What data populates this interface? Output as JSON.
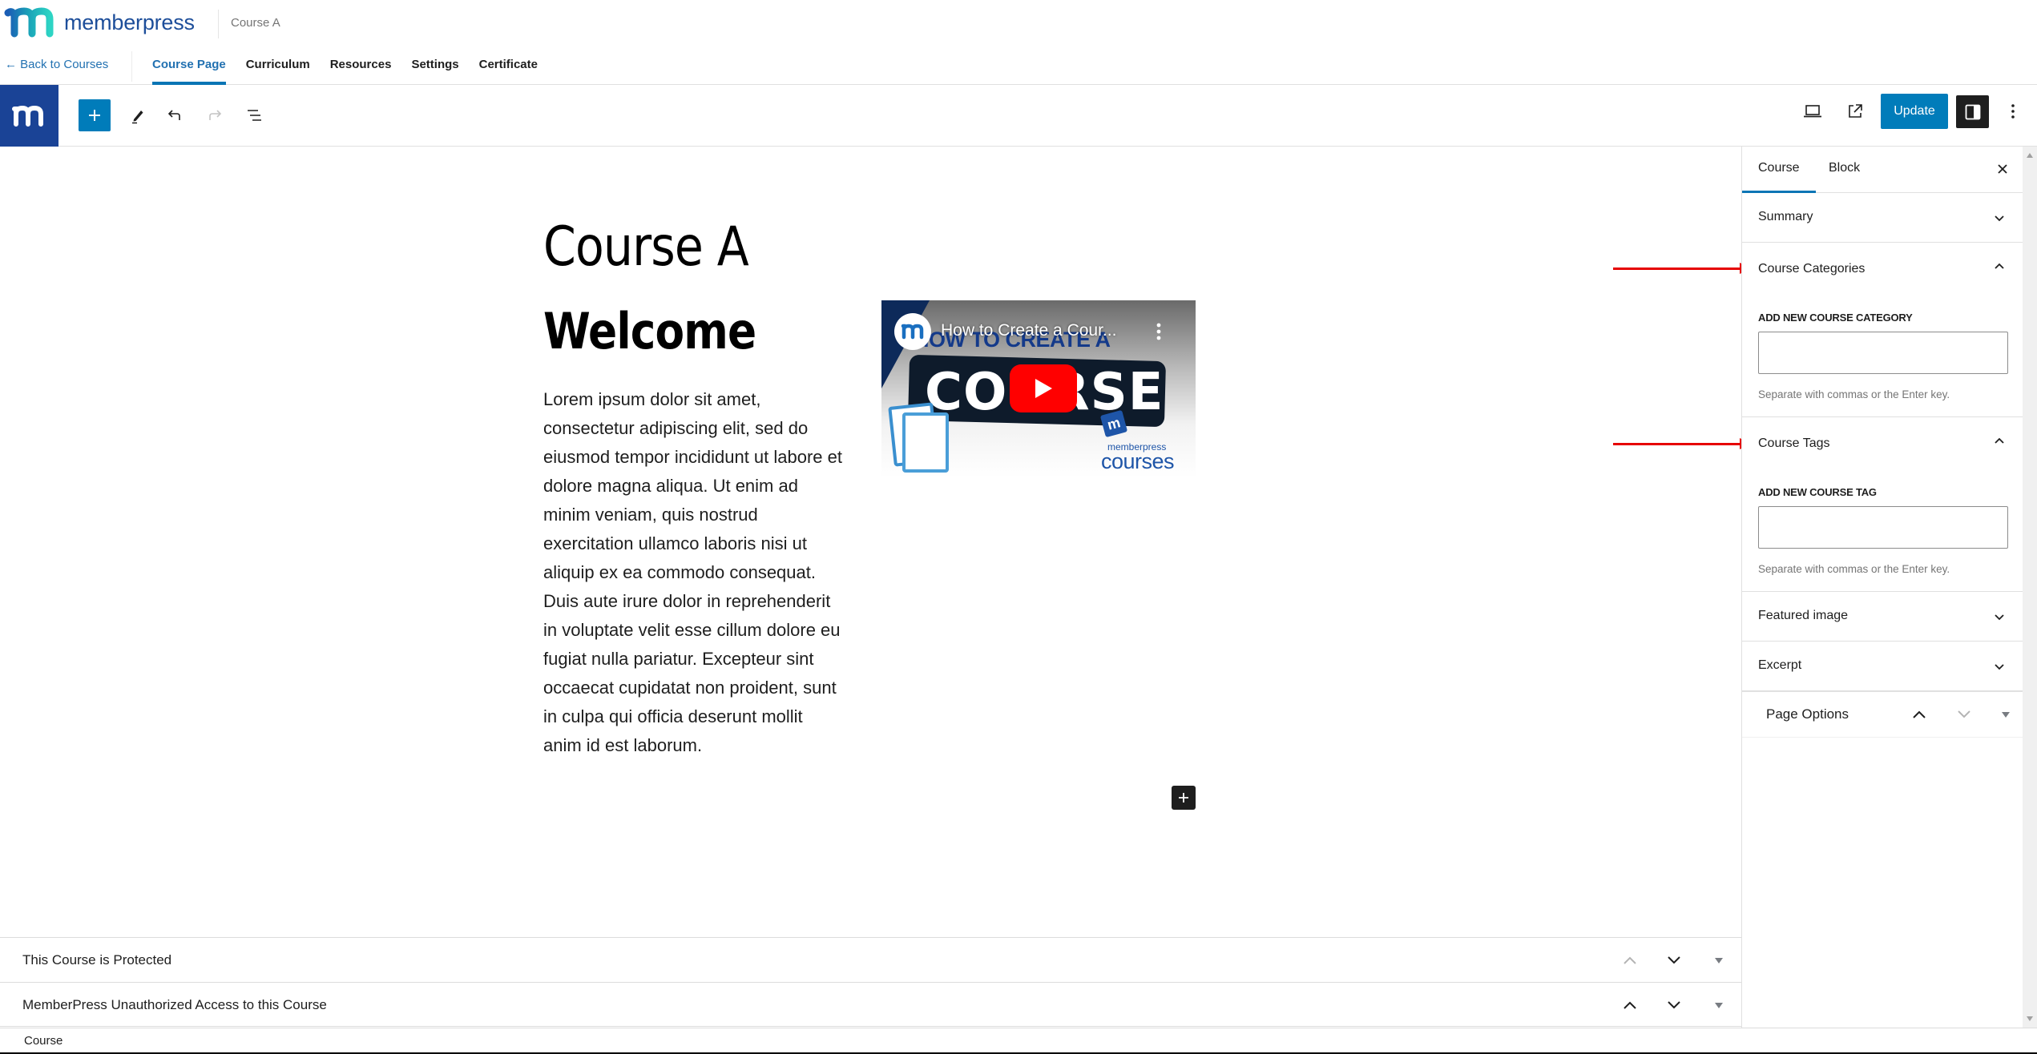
{
  "header": {
    "brand_name": "memberpress",
    "course_title": "Course A",
    "back_link": "← Back to Courses",
    "nav_tabs": [
      {
        "label": "Course Page",
        "active": true
      },
      {
        "label": "Curriculum",
        "active": false
      },
      {
        "label": "Resources",
        "active": false
      },
      {
        "label": "Settings",
        "active": false
      },
      {
        "label": "Certificate",
        "active": false
      }
    ]
  },
  "toolbar": {
    "left_icons": [
      "memberpress-logo-icon",
      "plus-icon",
      "pencil-icon",
      "undo-icon",
      "redo-icon",
      "list-view-icon"
    ],
    "right_icons": [
      "desktop-preview-icon",
      "external-link-icon",
      "sidebar-toggle-icon",
      "more-vertical-icon"
    ],
    "update_label": "Update",
    "accent_color": "#007cba"
  },
  "canvas": {
    "post_title": "Course A",
    "heading": "Welcome",
    "paragraph_lines": [
      "Lorem ipsum dolor sit amet,",
      "consectetur adipiscing elit, sed do",
      "eiusmod tempor incididunt ut labore et",
      "dolore magna aliqua. Ut enim ad",
      "minim veniam, quis nostrud",
      "exercitation ullamco laboris nisi ut",
      "aliquip ex ea commodo consequat.",
      "Duis aute irure dolor in reprehenderit",
      "in voluptate velit esse cillum dolore eu",
      "fugiat nulla pariatur. Excepteur sint",
      "occaecat cupidatat non proident, sunt",
      "in culpa qui officia deserunt mollit",
      "anim id est laborum."
    ],
    "video": {
      "title": "How to Create a Cour...",
      "thumb_headline": "HOW TO CREATE A",
      "thumb_big_word": "COURSE",
      "thumb_brand_small": "memberpress",
      "thumb_brand_big": "courses",
      "play_color": "#ff0000"
    }
  },
  "metaboxes": [
    {
      "label": "This Course is Protected",
      "up_enabled": false
    },
    {
      "label": "MemberPress Unauthorized Access to this Course",
      "up_enabled": true
    }
  ],
  "status_bar": {
    "breadcrumb": "Course"
  },
  "sidebar": {
    "tabs": [
      {
        "label": "Course",
        "active": true
      },
      {
        "label": "Block",
        "active": false
      }
    ],
    "panels": {
      "summary": {
        "title": "Summary",
        "expanded": false
      },
      "categories": {
        "title": "Course Categories",
        "expanded": true,
        "field_label": "ADD NEW COURSE CATEGORY",
        "value": "",
        "help": "Separate with commas or the Enter key."
      },
      "tags": {
        "title": "Course Tags",
        "expanded": true,
        "field_label": "ADD NEW COURSE TAG",
        "value": "",
        "help": "Separate with commas or the Enter key."
      },
      "featured_image": {
        "title": "Featured image",
        "expanded": false
      },
      "excerpt": {
        "title": "Excerpt",
        "expanded": false
      },
      "page_options": {
        "title": "Page Options"
      }
    }
  },
  "annotations": {
    "arrow_color": "#e60000",
    "targets": [
      "Course Categories",
      "Course Tags"
    ]
  }
}
